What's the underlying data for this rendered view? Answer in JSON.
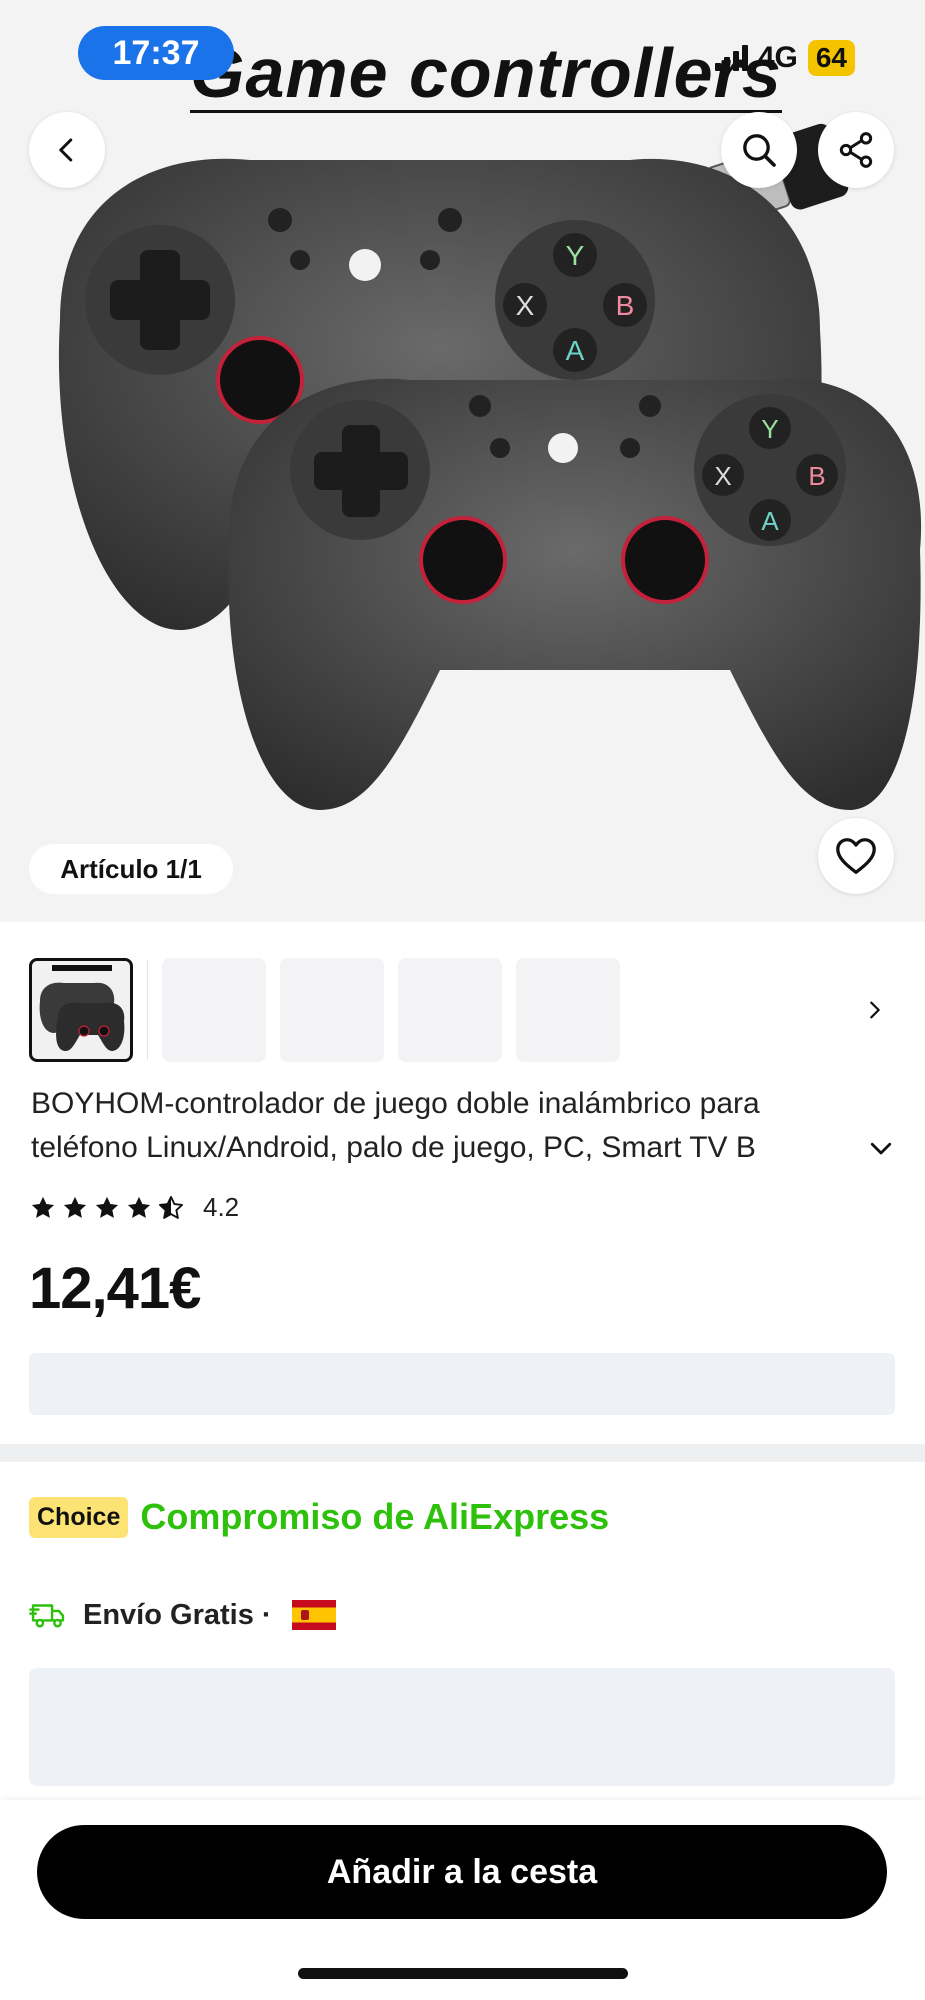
{
  "status_bar": {
    "time": "17:37",
    "network": "4G",
    "battery": "64"
  },
  "hero": {
    "image_caption": "Game controllers",
    "article_counter": "Artículo 1/1"
  },
  "product": {
    "title_line1": "BOYHOM-controlador de juego doble inalámbrico para",
    "title_line2": "teléfono Linux/Android, palo de juego, PC, Smart TV B",
    "rating": "4.2",
    "rating_stars": 4.2,
    "price": "12,41€"
  },
  "choice": {
    "badge": "Choice",
    "text": "Compromiso de AliExpress"
  },
  "shipping": {
    "label": "Envío Gratis ·"
  },
  "actions": {
    "add_to_cart": "Añadir a la cesta"
  },
  "colors": {
    "choice_green": "#2dc10b",
    "choice_badge": "#fde374",
    "status_time_bg": "#1a73e8",
    "battery_bg": "#f5c400",
    "cart_button": "#000000"
  },
  "icons": [
    "back-icon",
    "search-icon",
    "share-icon",
    "heart-icon",
    "chevron-right-icon",
    "chevron-down-icon",
    "star-icon",
    "truck-icon",
    "spain-flag-icon"
  ]
}
